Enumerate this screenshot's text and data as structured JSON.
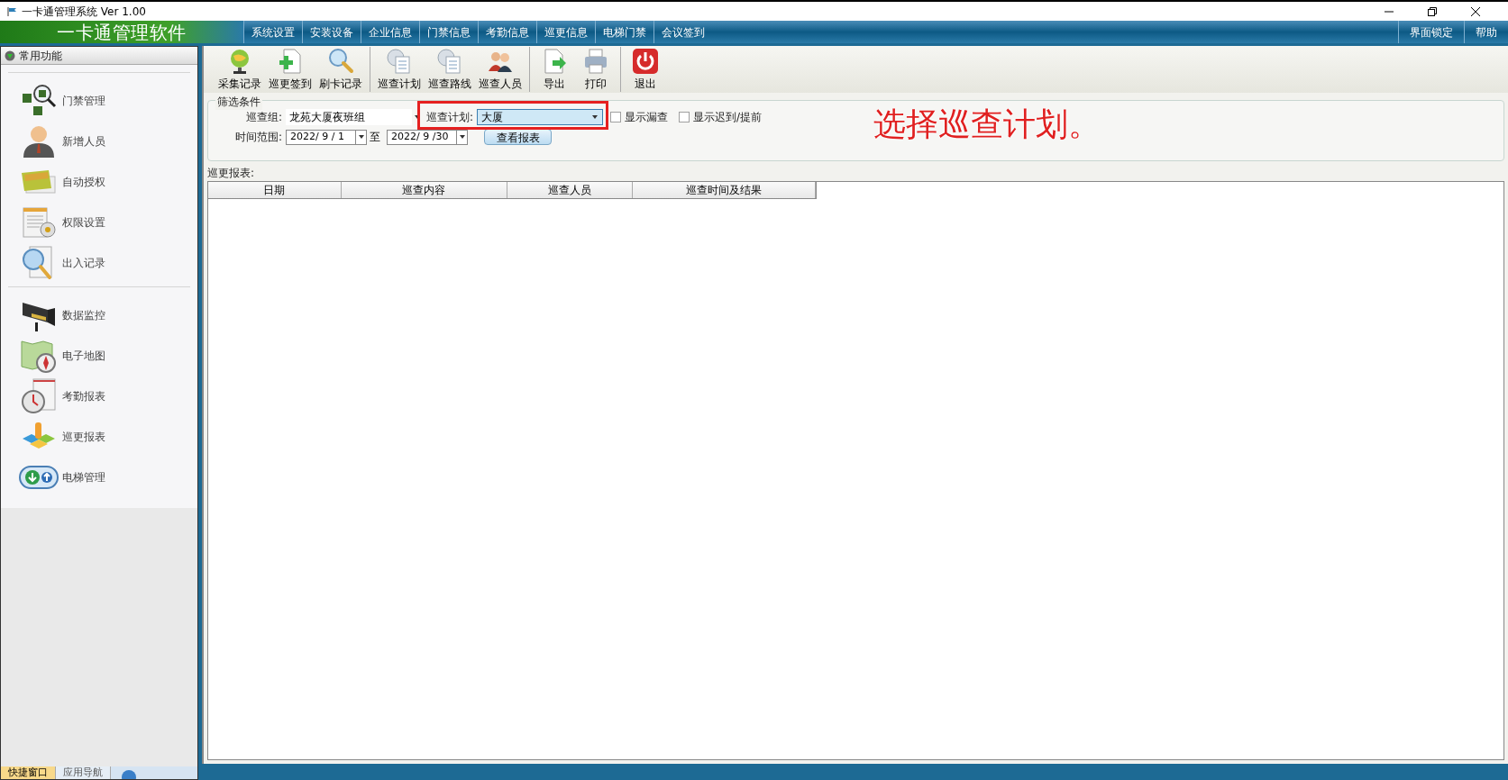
{
  "window": {
    "title": "一卡通管理系统  Ver 1.00"
  },
  "banner": {
    "app_name": "一卡通管理软件",
    "menu": [
      {
        "label": "系统设置"
      },
      {
        "label": "安装设备"
      },
      {
        "label": "企业信息"
      },
      {
        "label": "门禁信息"
      },
      {
        "label": "考勤信息"
      },
      {
        "label": "巡更信息"
      },
      {
        "label": "电梯门禁"
      },
      {
        "label": "会议签到"
      }
    ],
    "right_menu": [
      {
        "label": "界面锁定"
      },
      {
        "label": "帮助"
      }
    ]
  },
  "sidebar": {
    "header": "常用功能",
    "groups": [
      [
        {
          "label": "门禁管理",
          "kind": "chips"
        },
        {
          "label": "新增人员",
          "kind": "person"
        },
        {
          "label": "自动授权",
          "kind": "cards"
        },
        {
          "label": "权限设置",
          "kind": "doc"
        },
        {
          "label": "出入记录",
          "kind": "magnifier"
        }
      ],
      [
        {
          "label": "数据监控",
          "kind": "camera"
        },
        {
          "label": "电子地图",
          "kind": "map"
        },
        {
          "label": "考勤报表",
          "kind": "clock"
        },
        {
          "label": "巡更报表",
          "kind": "blocks"
        },
        {
          "label": "电梯管理",
          "kind": "elevator"
        }
      ]
    ],
    "tabs": [
      {
        "label": "快捷窗口",
        "selected": true
      },
      {
        "label": "应用导航",
        "selected": false
      }
    ]
  },
  "toolbar": [
    [
      {
        "label": "采集记录",
        "kind": "globe"
      },
      {
        "label": "巡更签到",
        "kind": "add"
      },
      {
        "label": "刷卡记录",
        "kind": "search"
      }
    ],
    [
      {
        "label": "巡查计划",
        "kind": "gear"
      },
      {
        "label": "巡查路线",
        "kind": "gear"
      },
      {
        "label": "巡查人员",
        "kind": "people"
      }
    ],
    [
      {
        "label": "导出",
        "kind": "export"
      },
      {
        "label": "打印",
        "kind": "print"
      }
    ],
    [
      {
        "label": "退出",
        "kind": "power"
      }
    ]
  ],
  "filter": {
    "title": "筛选条件",
    "group_label": "巡查组:",
    "group_value": "龙苑大厦夜班组",
    "plan_label": "巡查计划:",
    "plan_value": "大厦",
    "checkboxes": [
      {
        "label": "显示漏查",
        "checked": false
      },
      {
        "label": "显示迟到/提前",
        "checked": false
      }
    ],
    "range_label": "时间范围:",
    "date_from": "2022/ 9 / 1",
    "to_label": "至",
    "date_to": "2022/ 9 /30",
    "button": "查看报表"
  },
  "report": {
    "title": "巡更报表:",
    "columns": [
      "日期",
      "巡查内容",
      "巡查人员",
      "巡查时间及结果"
    ]
  },
  "annotation": "选择巡查计划。"
}
